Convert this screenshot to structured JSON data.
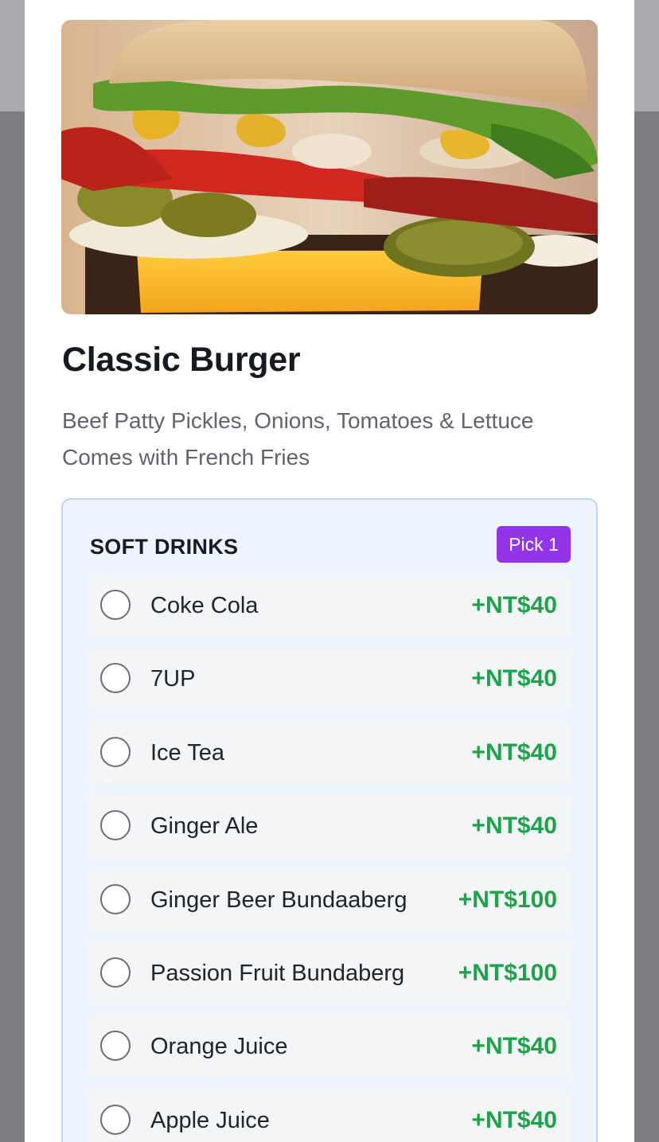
{
  "product": {
    "image_icon": "burger-photo",
    "name": "Classic Burger",
    "description_line1": "Beef Patty Pickles, Onions, Tomatoes & Lettuce",
    "description_line2": "Comes with French Fries"
  },
  "option_group": {
    "title": "SOFT DRINKS",
    "pick_label": "Pick 1",
    "options": [
      {
        "label": "Coke Cola",
        "price": "+NT$40"
      },
      {
        "label": "7UP",
        "price": "+NT$40"
      },
      {
        "label": "Ice Tea",
        "price": "+NT$40"
      },
      {
        "label": "Ginger Ale",
        "price": "+NT$40"
      },
      {
        "label": "Ginger Beer Bundaaberg",
        "price": "+NT$100"
      },
      {
        "label": "Passion Fruit Bundaberg",
        "price": "+NT$100"
      },
      {
        "label": "Orange Juice",
        "price": "+NT$40"
      },
      {
        "label": "Apple Juice",
        "price": "+NT$40"
      }
    ]
  },
  "colors": {
    "accent_purple": "#9333ea",
    "price_green": "#1fa34a",
    "group_background": "#eef4fe",
    "group_border": "#bcd5f3"
  }
}
